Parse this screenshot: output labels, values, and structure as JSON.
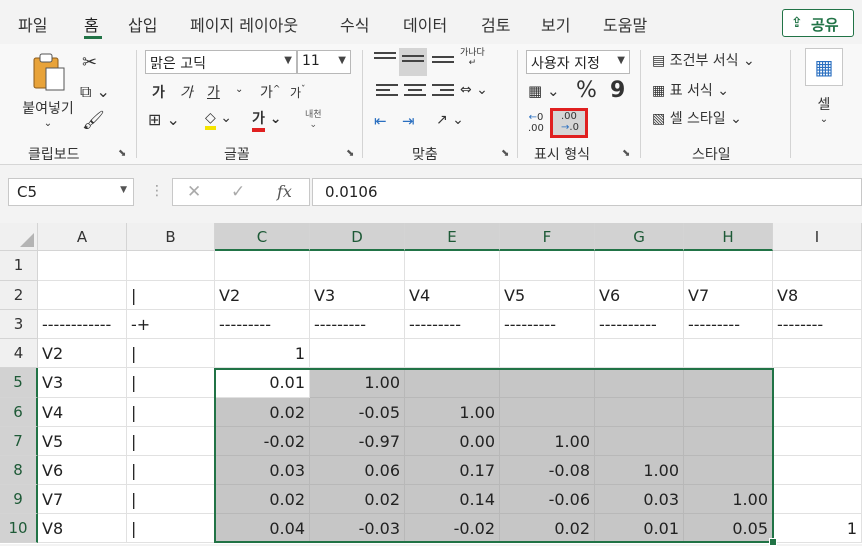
{
  "menu": {
    "items": [
      "파일",
      "홈",
      "삽입",
      "페이지 레이아웃",
      "수식",
      "데이터",
      "검토",
      "보기",
      "도움말"
    ],
    "share": "공유"
  },
  "ribbon": {
    "clipboard": {
      "paste": "붙여넣기",
      "label": "클립보드"
    },
    "font": {
      "name": "맑은 고딕",
      "size": "11",
      "label": "글꼴",
      "bold": "가",
      "italic": "가",
      "underline": "가",
      "grow": "가",
      "shrink": "가",
      "color_a": "가",
      "phonetic": "내천"
    },
    "alignment": {
      "label": "맞춤",
      "wrap": "가나다"
    },
    "number": {
      "format": "사용자 지정",
      "label": "표시 형식",
      "percent": "%",
      "comma": "9",
      "inc_decimal": ".00",
      "dec_decimal": ".00"
    },
    "styles": {
      "label": "스타일",
      "conditional": "조건부 서식",
      "table": "표 서식",
      "cell_styles": "셀 스타일"
    },
    "cells": {
      "label": "셀"
    }
  },
  "formula_bar": {
    "name_box": "C5",
    "fx": "fx",
    "value": "0.0106"
  },
  "columns": [
    "A",
    "B",
    "C",
    "D",
    "E",
    "F",
    "G",
    "H",
    "I"
  ],
  "rows": [
    "1",
    "2",
    "3",
    "4",
    "5",
    "6",
    "7",
    "8",
    "9",
    "10"
  ],
  "cells": {
    "r2": [
      "",
      "|",
      "V2",
      "V3",
      "V4",
      "V5",
      "V6",
      "V7",
      "V8"
    ],
    "r3": [
      "------------",
      "-+",
      "---------",
      "---------",
      "---------",
      "---------",
      "----------",
      "---------",
      "--------"
    ],
    "r4": [
      "V2",
      "|",
      "1",
      "",
      "",
      "",
      "",
      "",
      ""
    ],
    "r5": [
      "V3",
      "|",
      "0.01",
      "1.00",
      "",
      "",
      "",
      "",
      ""
    ],
    "r6": [
      "V4",
      "|",
      "0.02",
      "-0.05",
      "1.00",
      "",
      "",
      "",
      ""
    ],
    "r7": [
      "V5",
      "|",
      "-0.02",
      "-0.97",
      "0.00",
      "1.00",
      "",
      "",
      ""
    ],
    "r8": [
      "V6",
      "|",
      "0.03",
      "0.06",
      "0.17",
      "-0.08",
      "1.00",
      "",
      ""
    ],
    "r9": [
      "V7",
      "|",
      "0.02",
      "0.02",
      "0.14",
      "-0.06",
      "0.03",
      "1.00",
      ""
    ],
    "r10": [
      "V8",
      "|",
      "0.04",
      "-0.03",
      "-0.02",
      "0.02",
      "0.01",
      "0.05",
      "1"
    ]
  }
}
